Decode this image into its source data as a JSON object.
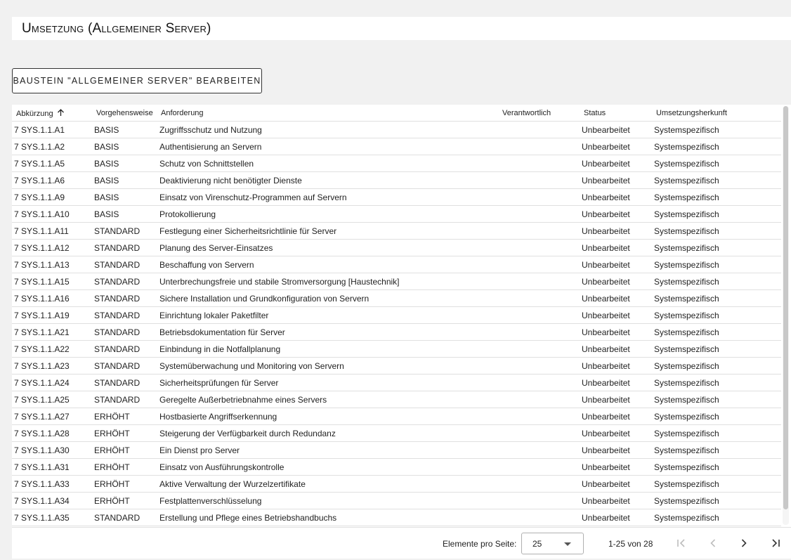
{
  "page": {
    "title": "Umsetzung (Allgemeiner Server)"
  },
  "actions": {
    "edit_label": "Baustein \"Allgemeiner Server\" bearbeiten"
  },
  "table": {
    "columns": [
      "Abkürzung",
      "Vorgehensweise",
      "Anforderung",
      "Verantwortlich",
      "Status",
      "Umsetzungsherkunft"
    ],
    "sort_column": "Abkürzung",
    "sort_direction": "ascending",
    "rows": [
      [
        "7 SYS.1.1.A1",
        "BASIS",
        "Zugriffsschutz und Nutzung",
        "",
        "Unbearbeitet",
        "Systemspezifisch"
      ],
      [
        "7 SYS.1.1.A2",
        "BASIS",
        "Authentisierung an Servern",
        "",
        "Unbearbeitet",
        "Systemspezifisch"
      ],
      [
        "7 SYS.1.1.A5",
        "BASIS",
        "Schutz von Schnittstellen",
        "",
        "Unbearbeitet",
        "Systemspezifisch"
      ],
      [
        "7 SYS.1.1.A6",
        "BASIS",
        "Deaktivierung nicht benötigter Dienste",
        "",
        "Unbearbeitet",
        "Systemspezifisch"
      ],
      [
        "7 SYS.1.1.A9",
        "BASIS",
        "Einsatz von Virenschutz-Programmen auf Servern",
        "",
        "Unbearbeitet",
        "Systemspezifisch"
      ],
      [
        "7 SYS.1.1.A10",
        "BASIS",
        "Protokollierung",
        "",
        "Unbearbeitet",
        "Systemspezifisch"
      ],
      [
        "7 SYS.1.1.A11",
        "STANDARD",
        "Festlegung einer Sicherheitsrichtlinie für Server",
        "",
        "Unbearbeitet",
        "Systemspezifisch"
      ],
      [
        "7 SYS.1.1.A12",
        "STANDARD",
        "Planung des Server-Einsatzes",
        "",
        "Unbearbeitet",
        "Systemspezifisch"
      ],
      [
        "7 SYS.1.1.A13",
        "STANDARD",
        "Beschaffung von Servern",
        "",
        "Unbearbeitet",
        "Systemspezifisch"
      ],
      [
        "7 SYS.1.1.A15",
        "STANDARD",
        "Unterbrechungsfreie und stabile Stromversorgung [Haustechnik]",
        "",
        "Unbearbeitet",
        "Systemspezifisch"
      ],
      [
        "7 SYS.1.1.A16",
        "STANDARD",
        "Sichere Installation und Grundkonfiguration von Servern",
        "",
        "Unbearbeitet",
        "Systemspezifisch"
      ],
      [
        "7 SYS.1.1.A19",
        "STANDARD",
        "Einrichtung lokaler Paketfilter",
        "",
        "Unbearbeitet",
        "Systemspezifisch"
      ],
      [
        "7 SYS.1.1.A21",
        "STANDARD",
        "Betriebsdokumentation für Server",
        "",
        "Unbearbeitet",
        "Systemspezifisch"
      ],
      [
        "7 SYS.1.1.A22",
        "STANDARD",
        "Einbindung in die Notfallplanung",
        "",
        "Unbearbeitet",
        "Systemspezifisch"
      ],
      [
        "7 SYS.1.1.A23",
        "STANDARD",
        "Systemüberwachung und Monitoring von Servern",
        "",
        "Unbearbeitet",
        "Systemspezifisch"
      ],
      [
        "7 SYS.1.1.A24",
        "STANDARD",
        "Sicherheitsprüfungen für Server",
        "",
        "Unbearbeitet",
        "Systemspezifisch"
      ],
      [
        "7 SYS.1.1.A25",
        "STANDARD",
        "Geregelte Außerbetriebnahme eines Servers",
        "",
        "Unbearbeitet",
        "Systemspezifisch"
      ],
      [
        "7 SYS.1.1.A27",
        "ERHÖHT",
        "Hostbasierte Angriffserkennung",
        "",
        "Unbearbeitet",
        "Systemspezifisch"
      ],
      [
        "7 SYS.1.1.A28",
        "ERHÖHT",
        "Steigerung der Verfügbarkeit durch Redundanz",
        "",
        "Unbearbeitet",
        "Systemspezifisch"
      ],
      [
        "7 SYS.1.1.A30",
        "ERHÖHT",
        "Ein Dienst pro Server",
        "",
        "Unbearbeitet",
        "Systemspezifisch"
      ],
      [
        "7 SYS.1.1.A31",
        "ERHÖHT",
        "Einsatz von Ausführungskontrolle",
        "",
        "Unbearbeitet",
        "Systemspezifisch"
      ],
      [
        "7 SYS.1.1.A33",
        "ERHÖHT",
        "Aktive Verwaltung der Wurzelzertifikate",
        "",
        "Unbearbeitet",
        "Systemspezifisch"
      ],
      [
        "7 SYS.1.1.A34",
        "ERHÖHT",
        "Festplattenverschlüsselung",
        "",
        "Unbearbeitet",
        "Systemspezifisch"
      ],
      [
        "7 SYS.1.1.A35",
        "STANDARD",
        "Erstellung und Pflege eines Betriebshandbuchs",
        "",
        "Unbearbeitet",
        "Systemspezifisch"
      ]
    ]
  },
  "paginator": {
    "items_per_page_label": "Elemente pro Seite:",
    "page_size": "25",
    "range_label": "1-25 von 28",
    "first_icon": "first-page-icon",
    "prev_icon": "chevron-left-icon",
    "next_icon": "chevron-right-icon",
    "last_icon": "last-page-icon"
  },
  "colors": {
    "background": "#f1f1f1",
    "surface": "#ffffff",
    "divider": "#e0e0e0",
    "disabled": "#bdbdbd"
  }
}
